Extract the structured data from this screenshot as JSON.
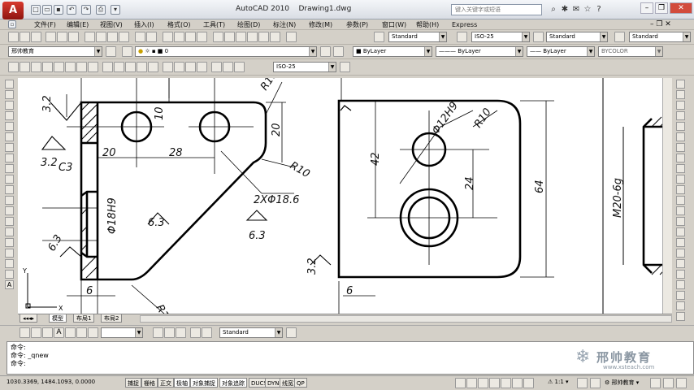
{
  "title": {
    "app": "AutoCAD 2010",
    "doc": "Drawing1.dwg"
  },
  "search": {
    "placeholder": "键入关键字或短语"
  },
  "menu": [
    "文件(F)",
    "编辑(E)",
    "视图(V)",
    "插入(I)",
    "格式(O)",
    "工具(T)",
    "绘图(D)",
    "标注(N)",
    "修改(M)",
    "参数(P)",
    "窗口(W)",
    "帮助(H)",
    "Express"
  ],
  "toolbar": {
    "text_style": "Standard",
    "dim_style": "ISO-25",
    "table_style": "Standard",
    "mleader_style": "Standard",
    "workspace": "邢帅教育",
    "layer": "0",
    "dim_style2": "ISO-25",
    "color": "ByLayer",
    "linetype": "ByLayer",
    "lineweight": "ByLayer",
    "plotstyle": "BYCOLOR",
    "bottom_style": "Standard"
  },
  "tabs": [
    "模型",
    "布局1",
    "布局2"
  ],
  "command": {
    "line1": "命令:",
    "line2": "命令: _qnew",
    "line3": "命令:"
  },
  "status": {
    "coords": "1030.3369,  1484.1093,  0.0000",
    "toggles": [
      "捕捉",
      "栅格",
      "正交",
      "极轴",
      "对象捕捉",
      "对象追踪",
      "DUCS",
      "DYN",
      "线宽",
      "QP"
    ],
    "scale": "1:1",
    "workspace": "邢帅教育"
  },
  "watermark": {
    "brand": "邢帅教育",
    "url": "www.xsteach.com"
  },
  "drawing": {
    "dims": {
      "d32a": "3.2",
      "d10": "10",
      "d20a": "20",
      "d28": "28",
      "r10a": "R10",
      "d20b": "20",
      "d32b": "3.2",
      "d20c": "20",
      "phi18h9": "Φ18H9",
      "d63a": "6.3",
      "d63b": "6.3",
      "twophi": "2XΦ18.6",
      "d63c": "6.3",
      "d6a": "6",
      "r10b": "R10",
      "phi12h9": "Φ12H9",
      "r10c": "R10",
      "d42": "42",
      "d24": "24",
      "d64": "64",
      "d32c": "3.2",
      "d6b": "6",
      "m20": "M20-6g"
    }
  }
}
